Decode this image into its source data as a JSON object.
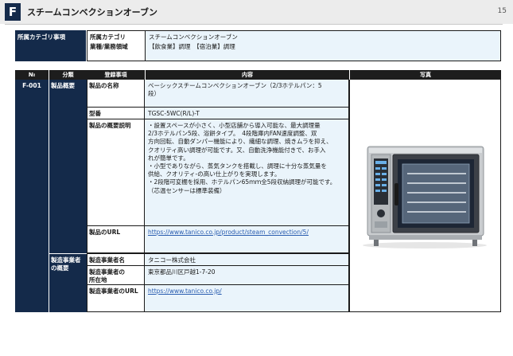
{
  "header": {
    "badge": "F",
    "title": "スチームコンベクションオーブン",
    "page_number": "15"
  },
  "category": {
    "section_label": "所属カテゴリ事項",
    "rows": [
      {
        "key": "所属カテゴリ",
        "value": "スチームコンベクションオーブン"
      },
      {
        "key": "業種/業務領域",
        "value": "【飲食業】調理　【宿泊業】調理"
      }
    ]
  },
  "table": {
    "headers": {
      "no": "№",
      "classification": "分類",
      "item": "登録事項",
      "content": "内容",
      "photo": "写真"
    },
    "entry_no": "F-001",
    "groups": {
      "product": "製品概要",
      "maker_line1": "製造事業者",
      "maker_line2": "の概要"
    },
    "rows": {
      "name_key": "製品の名称",
      "name_val_1": "ベーシックスチームコンベクションオーブン（2/3ホテルパン：5",
      "name_val_2": "段）",
      "model_key": "型番",
      "model_val": "TGSC-5WC(R/L)-T",
      "desc_key": "製品の概要説明",
      "desc_lines": [
        "・設置スペースが小さく、小型店舗から導入可能な、最大調理量",
        "2/3ホテルパン5段、浴餅タイプ。　4段階庫内FAN速度調整、双",
        "方向回転、自動ダンパー機能により、繊細な調理、焼きムラを抑え、",
        "クオリティ高い調理が可能です。又、自動洗浄機能付きで、お手入",
        "れが簡単です。",
        "・小型でありながら、蒸気タンクを搭載し、調理に十分な蒸気量を",
        "供給、クオリティ-の高い仕上がりを実現します。",
        "・2段階可変棚を採用、ホテルパン65ｍｍ全5段収納調理が可能です。",
        "（芯温センサーは標準装備）"
      ],
      "url_key": "製品のURL",
      "url_val": "https://www.tanico.co.jp/product/steam_convection/5/",
      "maker_name_key": "製造事業者名",
      "maker_name_val": "タニコー株式会社",
      "maker_addr_key_1": "製造事業者の",
      "maker_addr_key_2": "所在地",
      "maker_addr_val": "東京都品川区戸越1-7-20",
      "maker_url_key": "製造事業者のURL",
      "maker_url_val": "https://www.tanico.co.jp/"
    }
  },
  "colors": {
    "navy": "#142a4a",
    "light_blue": "#eaf4fb",
    "link": "#2a5db0"
  }
}
